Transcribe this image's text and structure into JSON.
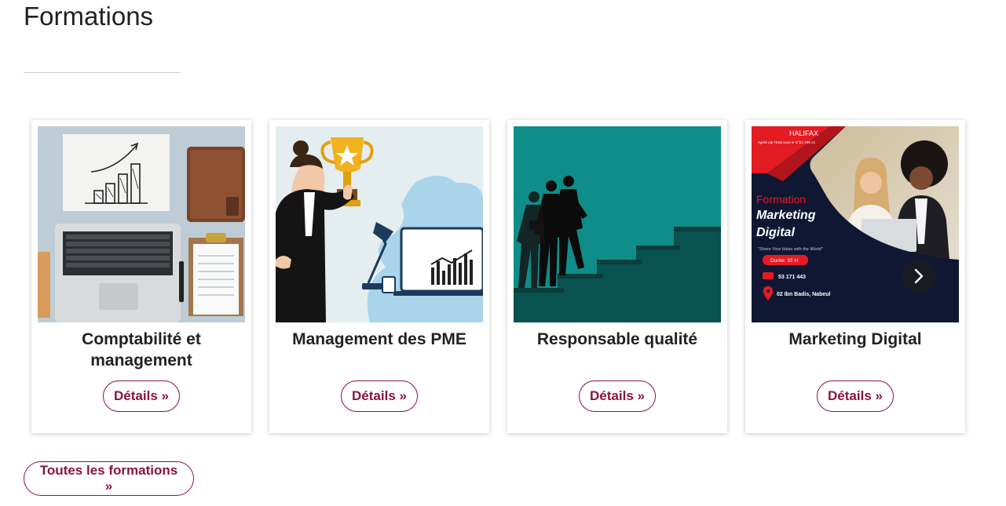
{
  "page": {
    "title": "Formations",
    "all_button": "Toutes les formations »"
  },
  "colors": {
    "accent": "#8a1538"
  },
  "cards": [
    {
      "title": "Comptabilité et management",
      "button": "Détails »",
      "image": "laptop-growth-chart-illustration"
    },
    {
      "title": "Management des PME",
      "button": "Détails »",
      "image": "businesswoman-trophy-illustration"
    },
    {
      "title": "Responsable qualité",
      "button": "Détails »",
      "image": "businessman-climbing-steps-illustration"
    },
    {
      "title": "Marketing Digital",
      "button": "Détails »",
      "image": "marketing-digital-flyer",
      "flyer": {
        "brand": "HALIFAX",
        "agreement": "Agréé par l'Etat sous le N°21-288-21",
        "line1": "Formation",
        "line2": "Marketing",
        "line3": "Digital",
        "tagline": "\"Share Your Ideas with the World\"",
        "duration": "Durée: 32 H",
        "phone": "53 171 443",
        "address": "02 Ibn Badis, Nabeul"
      }
    }
  ]
}
